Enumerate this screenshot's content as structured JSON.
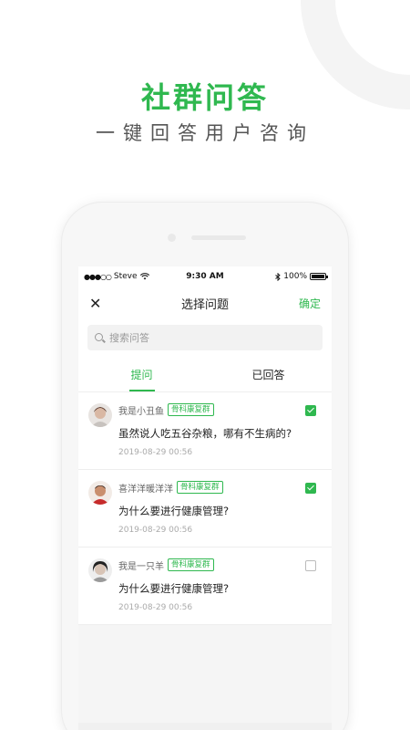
{
  "promo": {
    "title": "社群问答",
    "subtitle": "一键回答用户咨询"
  },
  "statusbar": {
    "carrier": "Steve",
    "time": "9:30 AM",
    "battery": "100%"
  },
  "navbar": {
    "close_label": "✕",
    "title": "选择问题",
    "confirm_label": "确定"
  },
  "search": {
    "placeholder": "搜索问答"
  },
  "tabs": [
    {
      "label": "提问",
      "active": true
    },
    {
      "label": "已回答",
      "active": false
    }
  ],
  "questions": [
    {
      "user": "我是小丑鱼",
      "badge": "骨科康复群",
      "text": "虽然说人吃五谷杂粮，哪有不生病的?",
      "time": "2019-08-29 00:56",
      "checked": true
    },
    {
      "user": "喜洋洋暖洋洋",
      "badge": "骨科康复群",
      "text": "为什么要进行健康管理?",
      "time": "2019-08-29 00:56",
      "checked": true
    },
    {
      "user": "我是一只羊",
      "badge": "骨科康复群",
      "text": "为什么要进行健康管理?",
      "time": "2019-08-29 00:56",
      "checked": false
    }
  ],
  "colors": {
    "accent": "#2fb84f",
    "text": "#222222",
    "muted": "#aaaaaa"
  }
}
